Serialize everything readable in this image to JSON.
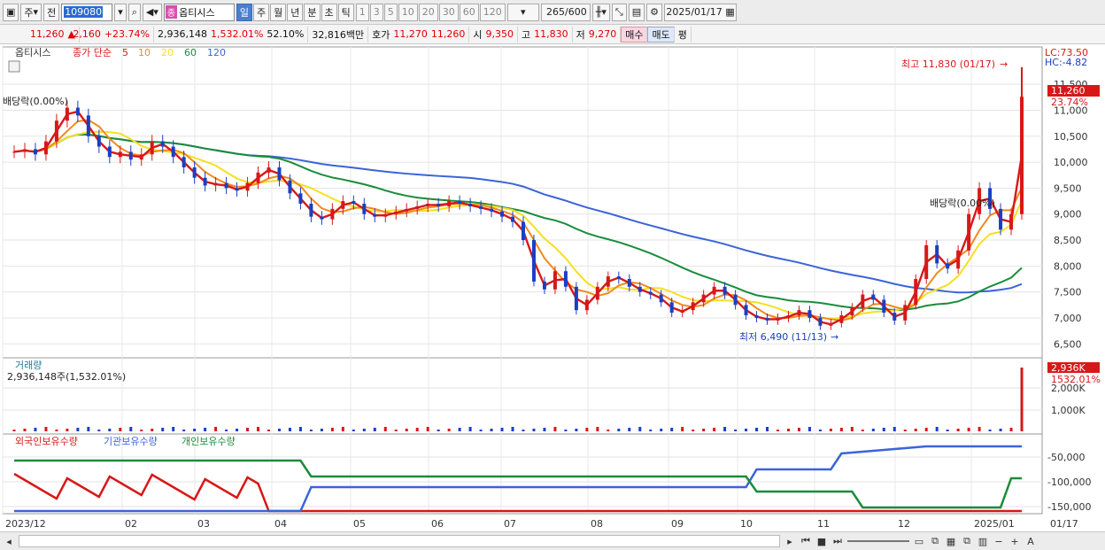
{
  "toolbar": {
    "market": "주",
    "prev_label": "전",
    "code": "109080",
    "stock_name": "옵티시스",
    "name_tag": "종",
    "periods": [
      "일",
      "주",
      "월",
      "년",
      "분",
      "초",
      "틱"
    ],
    "active_period": "일",
    "intervals": [
      "1",
      "3",
      "5",
      "10",
      "20",
      "30",
      "60",
      "120"
    ],
    "count": "265",
    "count_max": "/600",
    "date": "2025/01/17"
  },
  "quote": {
    "price": "11,260",
    "change": "2,160",
    "change_pct": "+23.74%",
    "volume": "2,936,148",
    "volume_pct": "1,532.01%",
    "turnover_ratio": "52.10%",
    "amount": "32,816백만",
    "ask_label": "호가",
    "ask": "11,270",
    "bid": "11,260",
    "open_label": "시",
    "open": "9,350",
    "high_label": "고",
    "high": "11,830",
    "low_label": "저",
    "low": "9,270",
    "buy_label": "매수",
    "sell_label": "매도",
    "eval_label": "평"
  },
  "chart_legend": {
    "name": "옵티시스",
    "price_label": "종가 단순",
    "ma": [
      "5",
      "10",
      "20",
      "60",
      "120"
    ],
    "lc": "LC:73.50",
    "hc": "HC:-4.82"
  },
  "annotations": {
    "high": "최고 11,830 (01/17)",
    "low": "최저 6,490 (11/13)",
    "dividend1": "배당락(0.00%)",
    "dividend2": "배당락(0.00%)",
    "last_price": "11,260",
    "last_pct": "23.74%"
  },
  "volume_panel": {
    "title": "거래량",
    "summary": "2,936,148주(1,532.01%)",
    "last": "2,936K",
    "last_pct": "1532.01%"
  },
  "holdings_panel": {
    "labels": [
      "외국인보유수량",
      "기관보유수량",
      "개인보유수량"
    ]
  },
  "colors": {
    "up": "#d81818",
    "down": "#1a3fc4",
    "ma5": "#d81818",
    "ma10": "#f08a1c",
    "ma20": "#f4e020",
    "ma60": "#1a8c3a",
    "ma120": "#3a64d8"
  },
  "chart_data": {
    "type": "line",
    "series": [
      {
        "name": "종가",
        "values": [
          10200,
          10250,
          10150,
          10400,
          10800,
          11050,
          10900,
          10500,
          10300,
          10100,
          10200,
          10050,
          10150,
          10400,
          10300,
          10100,
          9900,
          9700,
          9550,
          9600,
          9500,
          9450,
          9600,
          9800,
          9900,
          9650,
          9400,
          9200,
          8950,
          8900,
          9100,
          9250,
          9200,
          9000,
          8950,
          9000,
          9050,
          9100,
          9150,
          9200,
          9150,
          9250,
          9200,
          9150,
          9100,
          9050,
          8950,
          8850,
          8500,
          7700,
          7550,
          7900,
          7600,
          7150,
          7350,
          7600,
          7800,
          7750,
          7600,
          7500,
          7450,
          7300,
          7100,
          7150,
          7300,
          7450,
          7600,
          7450,
          7250,
          7050,
          7000,
          6950,
          7000,
          7050,
          7150,
          7000,
          6850,
          6900,
          7050,
          7200,
          7450,
          7350,
          7100,
          6950,
          7250,
          7750,
          8400,
          8050,
          7950,
          8300,
          9000,
          9500,
          9100,
          8700,
          9000,
          11260
        ]
      },
      {
        "name": "5",
        "values": []
      },
      {
        "name": "10",
        "values": []
      },
      {
        "name": "20",
        "values": []
      },
      {
        "name": "60",
        "values": []
      },
      {
        "name": "120",
        "values": []
      }
    ],
    "x_tick_labels": [
      "2023/12",
      "02",
      "03",
      "04",
      "05",
      "06",
      "07",
      "08",
      "09",
      "10",
      "11",
      "12",
      "2025/01",
      "01/17"
    ],
    "y_tick_labels": [
      "11,500",
      "11,000",
      "10,500",
      "10,000",
      "9,500",
      "9,000",
      "8,500",
      "8,000",
      "7,500",
      "7,000",
      "6,500"
    ],
    "ylim": [
      6300,
      12100
    ],
    "volume_ticks": [
      "2,000K",
      "1,000K"
    ],
    "holdings_ticks": [
      "-50,000",
      "-100,000",
      "-150,000"
    ]
  }
}
